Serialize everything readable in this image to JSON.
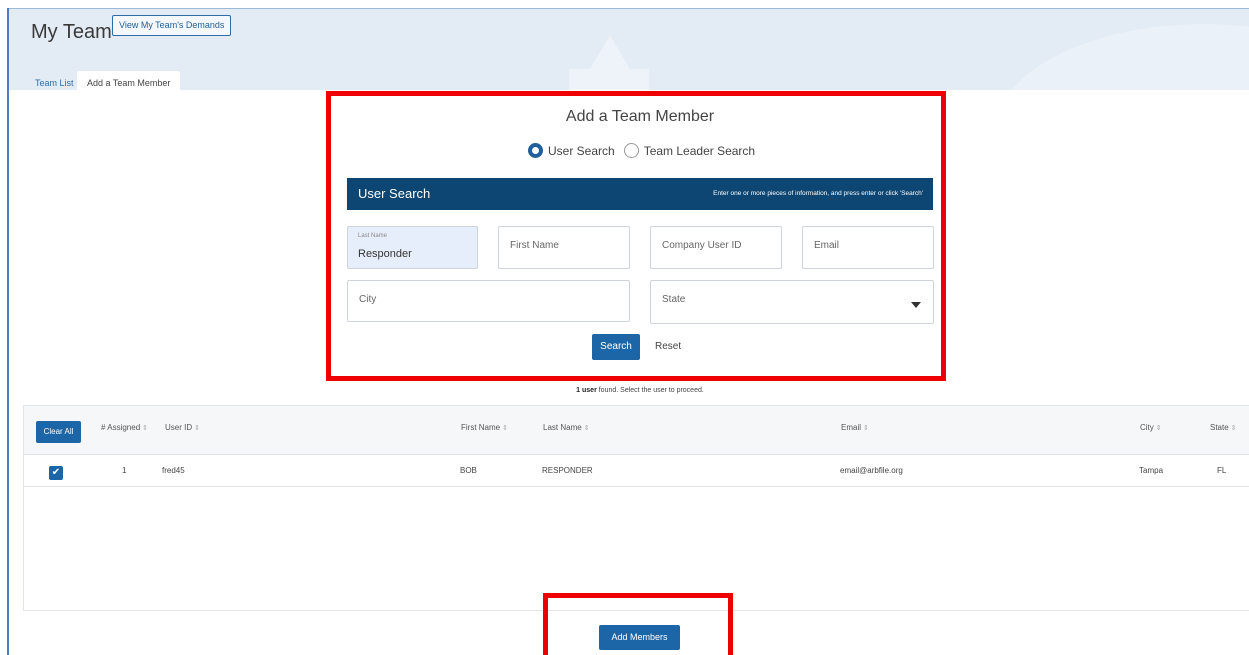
{
  "header": {
    "title": "My Team",
    "demands_button": "View My Team's Demands"
  },
  "tabs": {
    "team_list": "Team List",
    "add_member": "Add a Team Member"
  },
  "form": {
    "title": "Add a Team Member",
    "radio_user": "User Search",
    "radio_leader": "Team Leader Search",
    "bar_title": "User Search",
    "bar_hint": "Enter one or more pieces of information, and press enter or click 'Search'",
    "last_name_label": "Last Name",
    "last_name_value": "Responder",
    "first_name_ph": "First Name",
    "company_user_id_ph": "Company User ID",
    "email_ph": "Email",
    "city_ph": "City",
    "state_ph": "State",
    "search_button": "Search",
    "reset_link": "Reset"
  },
  "results": {
    "count": "1 user",
    "suffix": " found. Select the user to proceed."
  },
  "table": {
    "clear_all": "Clear All",
    "headers": {
      "assigned": "# Assigned",
      "user_id": "User ID",
      "first_name": "First Name",
      "last_name": "Last Name",
      "email": "Email",
      "city": "City",
      "state": "State"
    },
    "rows": [
      {
        "assigned": "1",
        "user_id": "fred45",
        "first_name": "BOB",
        "last_name": "RESPONDER",
        "email": "email@arbfile.org",
        "city": "Tampa",
        "state": "FL"
      }
    ]
  },
  "add_members_button": "Add Members",
  "colors": {
    "primary": "#1c66a8",
    "bar": "#0d4673",
    "highlight": "#ee0000"
  }
}
